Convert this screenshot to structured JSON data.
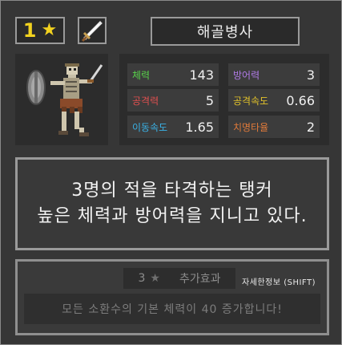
{
  "unit": {
    "rank": "1",
    "name": "해골병사"
  },
  "stats": [
    {
      "label": "체력",
      "value": "143",
      "color": "#58d24a"
    },
    {
      "label": "방어력",
      "value": "3",
      "color": "#b07ae6"
    },
    {
      "label": "공격력",
      "value": "5",
      "color": "#e05050"
    },
    {
      "label": "공격속도",
      "value": "0.66",
      "color": "#e2c22a"
    },
    {
      "label": "이동속도",
      "value": "1.65",
      "color": "#3ab2e6"
    },
    {
      "label": "치명타율",
      "value": "2",
      "color": "#e07a3a"
    }
  ],
  "description": {
    "line1": "3명의 적을 타격하는 탱커",
    "line2": "높은 체력과 방어력을 지니고 있다."
  },
  "bonus": {
    "count": "3",
    "title": "추가효과",
    "detail_label": "자세한정보 (SHIFT)",
    "text": "모든 소환수의 기본 체력이 40 증가합니다!"
  },
  "icons": {
    "rank_star": "star-icon",
    "weapon": "sword-icon",
    "bonus_star": "star-icon"
  },
  "colors": {
    "star": "#f2d21f",
    "panel": "#363636",
    "border": "#9a9a9a"
  }
}
